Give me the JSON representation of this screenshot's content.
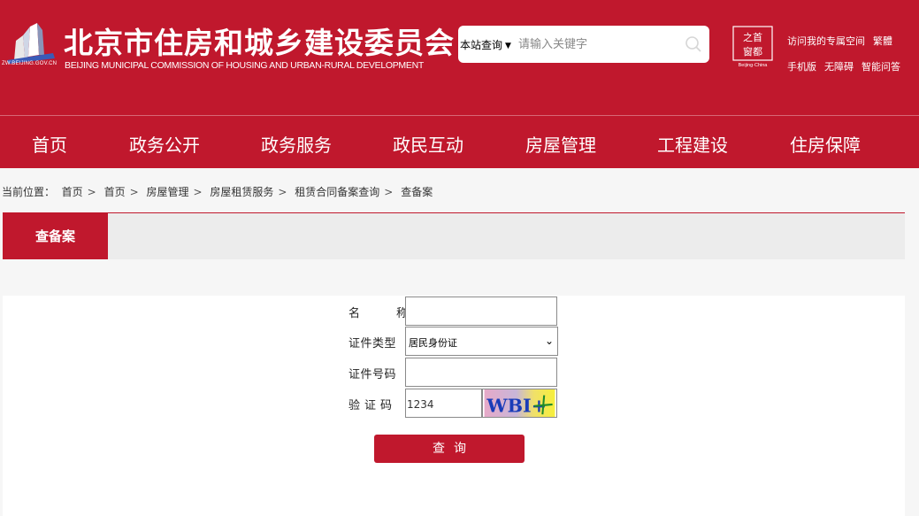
{
  "header": {
    "logo_url_text": "ZW.BEIJING.GOV.CN",
    "title": "北京市住房和城乡建设委员会",
    "subtitle": "BEIJING MUNICIPAL COMMISSION OF HOUSING AND URBAN-RURAL DEVELOPMENT",
    "search": {
      "scope_label": "本站查询",
      "placeholder": "请输入关键字"
    },
    "capital_badge": {
      "text": "首都之窗",
      "caption": "Beijing·China"
    },
    "top_links": [
      [
        "访问我的专属空间",
        "繁體"
      ],
      [
        "手机版",
        "无障碍",
        "智能问答"
      ]
    ]
  },
  "nav": {
    "items": [
      "首页",
      "政务公开",
      "政务服务",
      "政民互动",
      "房屋管理",
      "工程建设",
      "住房保障"
    ]
  },
  "breadcrumb": {
    "prefix": "当前位置：",
    "items": [
      "首页",
      "首页",
      "房屋管理",
      "房屋租赁服务",
      "租赁合同备案查询",
      "查备案"
    ],
    "separator": ">"
  },
  "tab": {
    "active_label": "查备案"
  },
  "form": {
    "name_label": "名　称",
    "name_value": "",
    "id_type_label": "证件类型",
    "id_type_value": "居民身份证",
    "id_number_label": "证件号码",
    "id_number_value": "",
    "captcha_label": "验证码",
    "captcha_value": "1234",
    "captcha_image_text": "WBI+",
    "submit_label": "查询"
  },
  "colors": {
    "brand_red": "#c0182d",
    "tab_bg": "#ececec",
    "page_bg": "#f6f6f6"
  }
}
